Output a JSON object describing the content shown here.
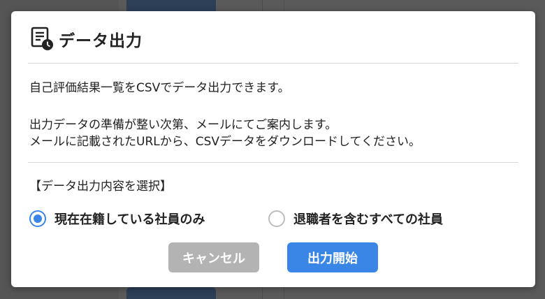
{
  "dialog": {
    "title": "データ出力",
    "icon": "document-clock-icon",
    "description_line1": "自己評価結果一覧をCSVでデータ出力できます。",
    "description_line2": "出力データの準備が整い次第、メールにてご案内します。",
    "description_line3": "メールに記載されたURLから、CSVデータをダウンロードしてください。",
    "selection_heading": "【データ出力内容を選択】",
    "options": [
      {
        "label": "現在在籍している社員のみ",
        "selected": true
      },
      {
        "label": "退職者を含むすべての社員",
        "selected": false
      }
    ],
    "cancel_label": "キャンセル",
    "start_label": "出力開始"
  },
  "colors": {
    "accent": "#3a86e6",
    "cancel_button": "#b3b3b3",
    "overlay": "#5a5a5a"
  }
}
